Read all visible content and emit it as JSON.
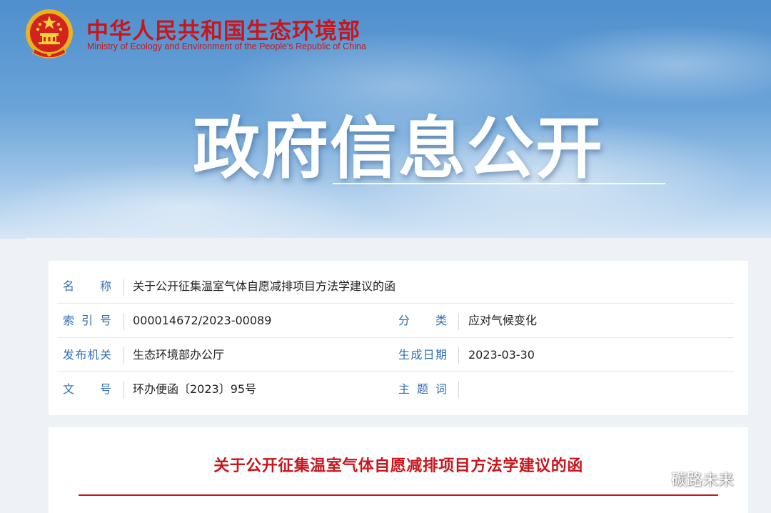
{
  "header": {
    "ministry_cn": "中华人民共和国生态环境部",
    "ministry_en": "Ministry of Ecology and Environment of the People's Republic of China",
    "banner_title": "政府信息公开",
    "emblem_icon": "national-emblem-icon"
  },
  "colors": {
    "brand_red": "#c8161d",
    "label_blue": "#2f6db3"
  },
  "info": {
    "name_label": "名称",
    "name_value": "关于公开征集温室气体自愿减排项目方法学建议的函",
    "index_label": "索引号",
    "index_value": "000014672/2023-00089",
    "category_label": "分类",
    "category_value": "应对气候变化",
    "publisher_label": "发布机关",
    "publisher_value": "生态环境部办公厅",
    "date_label": "生成日期",
    "date_value": "2023-03-30",
    "docno_label": "文号",
    "docno_value": "环办便函〔2023〕95号",
    "topic_label": "主题词",
    "topic_value": ""
  },
  "document": {
    "title": "关于公开征集温室气体自愿减排项目方法学建议的函"
  },
  "watermark": {
    "text": "碳路未来",
    "icon": "wechat-icon"
  }
}
